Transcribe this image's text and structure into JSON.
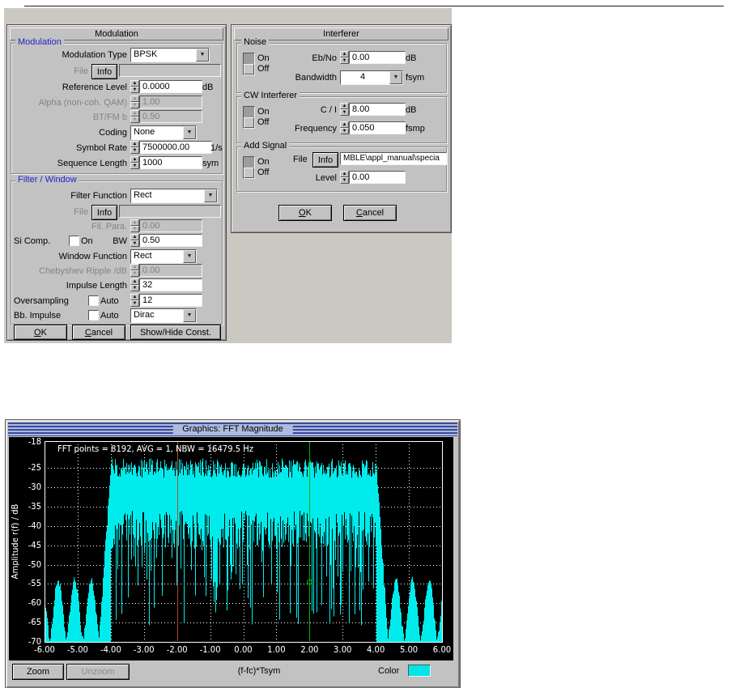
{
  "icons": {
    "dropdown_arrow": "▼",
    "spin_up": "▲",
    "spin_down": "▼"
  },
  "mod": {
    "title": "Modulation",
    "sec1": "Modulation",
    "rows": {
      "type": {
        "label": "Modulation Type",
        "value": "BPSK"
      },
      "file": {
        "label": "File",
        "btn": "Info",
        "value": ""
      },
      "ref": {
        "label": "Reference Level",
        "value": "0.0000",
        "unit": "dB"
      },
      "alpha": {
        "label": "Alpha (non-coh. QAM)",
        "value": "1.00"
      },
      "bt": {
        "label": "BT/FM b",
        "value": "0.50"
      },
      "coding": {
        "label": "Coding",
        "value": "None"
      },
      "symrate": {
        "label": "Symbol Rate",
        "value": "7500000.00",
        "unit": "1/s"
      },
      "seqlen": {
        "label": "Sequence Length",
        "value": "1000",
        "unit": "sym"
      }
    },
    "sec2": "Filter / Window",
    "rows2": {
      "filter": {
        "label": "Filter Function",
        "value": "Rect"
      },
      "file": {
        "label": "File",
        "btn": "Info",
        "value": ""
      },
      "filpara": {
        "label": "Fil. Para.",
        "value": "0.00"
      },
      "sicomp": {
        "label": "Si Comp.",
        "chk": "On",
        "bw": "BW",
        "value": "0.50"
      },
      "window": {
        "label": "Window Function",
        "value": "Rect"
      },
      "cheby": {
        "label": "Chebyshev Ripple /dB",
        "value": "0.00"
      },
      "implen": {
        "label": "Impulse Length",
        "value": "32"
      },
      "oversamp": {
        "label": "Oversampling",
        "chk": "Auto",
        "value": "12"
      },
      "bbimp": {
        "label": "Bb. Impulse",
        "chk": "Auto",
        "value": "Dirac"
      }
    },
    "ok": "OK",
    "cancel": "Cancel",
    "showhide": "Show/Hide Const."
  },
  "intf": {
    "title": "Interferer",
    "noise": {
      "label": "Noise",
      "on": "On",
      "off": "Off",
      "r1": {
        "label": "Eb/No",
        "value": "0.00",
        "unit": "dB"
      },
      "r2": {
        "label": "Bandwidth",
        "value": "4",
        "unit": "fsym"
      }
    },
    "cw": {
      "label": "CW Interferer",
      "on": "On",
      "off": "Off",
      "r1": {
        "label": "C / I",
        "value": "8.00",
        "unit": "dB"
      },
      "r2": {
        "label": "Frequency",
        "value": "0.050",
        "unit": "fsmp"
      }
    },
    "add": {
      "label": "Add Signal",
      "on": "On",
      "off": "Off",
      "file": {
        "label": "File",
        "btn": "Info",
        "value": "MBLE\\appl_manual\\specia"
      },
      "level": {
        "label": "Level",
        "value": "0.00"
      }
    },
    "ok": "OK",
    "cancel": "Cancel"
  },
  "gfx": {
    "title": "Graphics: FFT Magnitude",
    "zoom": "Zoom",
    "unzoom": "Unzoom",
    "color": "Color",
    "swatch": "#00e6e6"
  },
  "chart_data": {
    "type": "line",
    "title": "Graphics: FFT Magnitude",
    "annotation": "FFT points = 8192, AVG = 1, NBW = 16479.5 Hz",
    "xlabel": "(f-fc)*Tsym",
    "ylabel": "Amplitude r(f) / dB",
    "xlim": [
      -6,
      6
    ],
    "ylim": [
      -70,
      -18
    ],
    "x_ticks": [
      -6,
      -5,
      -4,
      -3,
      -2,
      -1,
      0,
      1,
      2,
      3,
      4,
      5,
      6
    ],
    "x_tick_labels": [
      "-6.00",
      "-5.00",
      "-4.00",
      "-3.00",
      "-2.00",
      "-1.00",
      "0.00",
      "1.00",
      "2.00",
      "3.00",
      "4.00",
      "5.00",
      "6.00"
    ],
    "y_ticks": [
      -18,
      -25,
      -30,
      -35,
      -40,
      -45,
      -50,
      -55,
      -60,
      -65,
      -70
    ],
    "grid": true,
    "background": "#000000",
    "axis_color": "#ffffff",
    "trace_color": "#00ecec",
    "spectrum_envelope": {
      "passband_x": [
        -4.0,
        4.0
      ],
      "passband_top_dB": [
        -27.5,
        -22.5
      ],
      "passband_body_dB": [
        -46,
        -36
      ],
      "spike_min_dB": -66,
      "spike_prob": 0.3,
      "rolloff_width": 0.35,
      "sidelobe_period": 0.5,
      "sidelobe_peak_dB": -55,
      "floor_dB": -70
    },
    "noise_seed": 1234,
    "cursor_lines": [
      {
        "x": -2.0,
        "color": "#a84a28"
      },
      {
        "x": 2.0,
        "color": "#00b400"
      }
    ],
    "marker": {
      "x": 2.0,
      "y": -54.5,
      "color": "#00c800"
    }
  }
}
